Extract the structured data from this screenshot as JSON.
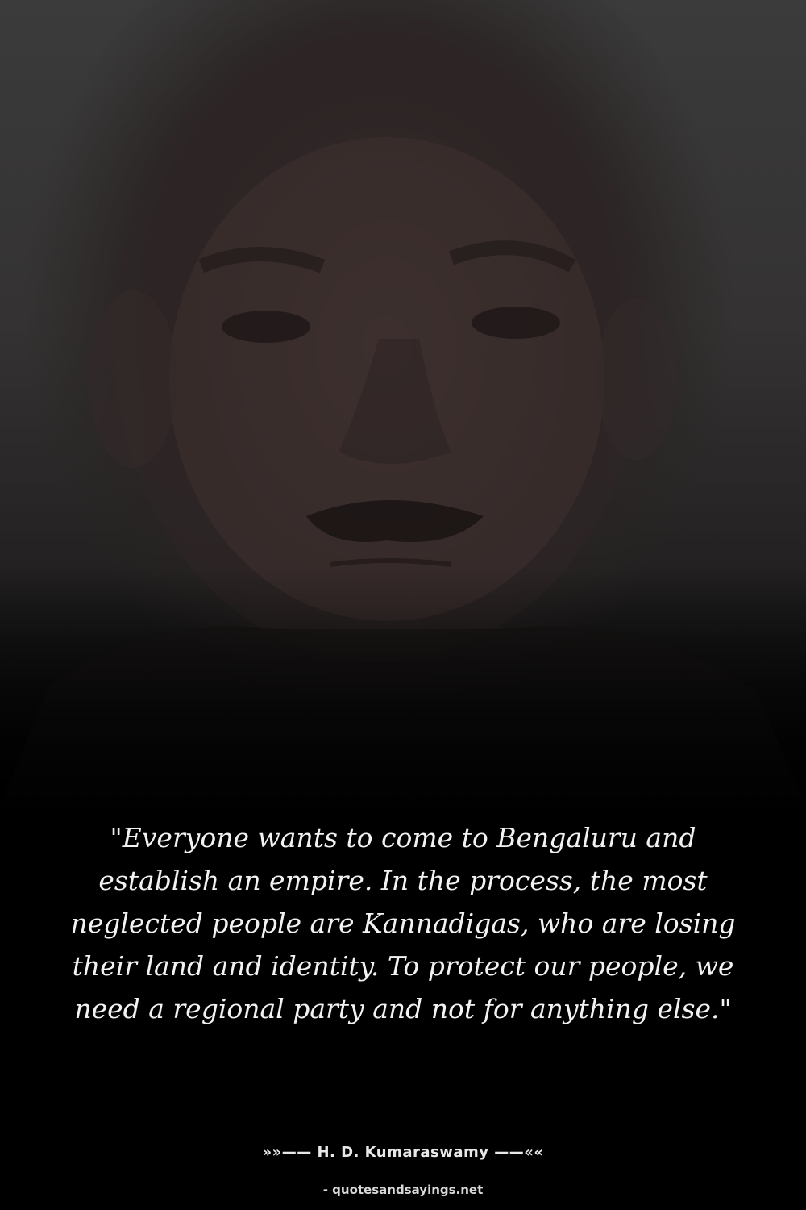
{
  "quote": {
    "text": "\"Everyone wants to come to Bengaluru and establish an empire. In the process, the most neglected people are Kannadigas, who are losing their land and identity. To protect our people, we need a regional party and not for anything else.\""
  },
  "author": {
    "text": "»»—— H. D. Kumaraswamy ——««"
  },
  "source": {
    "text": "- quotesandsayings.net"
  },
  "colors": {
    "background": "#000000",
    "text": "#f2f2f2"
  }
}
